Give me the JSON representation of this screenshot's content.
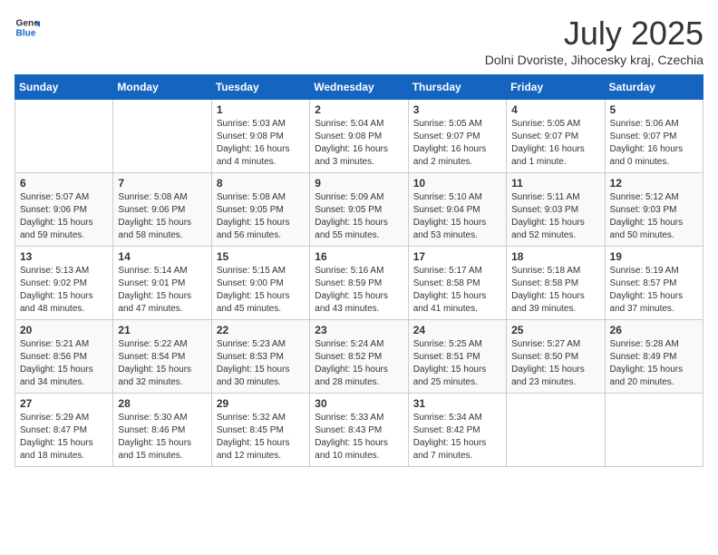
{
  "header": {
    "logo_general": "General",
    "logo_blue": "Blue",
    "title": "July 2025",
    "subtitle": "Dolni Dvoriste, Jihocesky kraj, Czechia"
  },
  "calendar": {
    "days_of_week": [
      "Sunday",
      "Monday",
      "Tuesday",
      "Wednesday",
      "Thursday",
      "Friday",
      "Saturday"
    ],
    "weeks": [
      [
        {
          "day": "",
          "info": ""
        },
        {
          "day": "",
          "info": ""
        },
        {
          "day": "1",
          "info": "Sunrise: 5:03 AM\nSunset: 9:08 PM\nDaylight: 16 hours\nand 4 minutes."
        },
        {
          "day": "2",
          "info": "Sunrise: 5:04 AM\nSunset: 9:08 PM\nDaylight: 16 hours\nand 3 minutes."
        },
        {
          "day": "3",
          "info": "Sunrise: 5:05 AM\nSunset: 9:07 PM\nDaylight: 16 hours\nand 2 minutes."
        },
        {
          "day": "4",
          "info": "Sunrise: 5:05 AM\nSunset: 9:07 PM\nDaylight: 16 hours\nand 1 minute."
        },
        {
          "day": "5",
          "info": "Sunrise: 5:06 AM\nSunset: 9:07 PM\nDaylight: 16 hours\nand 0 minutes."
        }
      ],
      [
        {
          "day": "6",
          "info": "Sunrise: 5:07 AM\nSunset: 9:06 PM\nDaylight: 15 hours\nand 59 minutes."
        },
        {
          "day": "7",
          "info": "Sunrise: 5:08 AM\nSunset: 9:06 PM\nDaylight: 15 hours\nand 58 minutes."
        },
        {
          "day": "8",
          "info": "Sunrise: 5:08 AM\nSunset: 9:05 PM\nDaylight: 15 hours\nand 56 minutes."
        },
        {
          "day": "9",
          "info": "Sunrise: 5:09 AM\nSunset: 9:05 PM\nDaylight: 15 hours\nand 55 minutes."
        },
        {
          "day": "10",
          "info": "Sunrise: 5:10 AM\nSunset: 9:04 PM\nDaylight: 15 hours\nand 53 minutes."
        },
        {
          "day": "11",
          "info": "Sunrise: 5:11 AM\nSunset: 9:03 PM\nDaylight: 15 hours\nand 52 minutes."
        },
        {
          "day": "12",
          "info": "Sunrise: 5:12 AM\nSunset: 9:03 PM\nDaylight: 15 hours\nand 50 minutes."
        }
      ],
      [
        {
          "day": "13",
          "info": "Sunrise: 5:13 AM\nSunset: 9:02 PM\nDaylight: 15 hours\nand 48 minutes."
        },
        {
          "day": "14",
          "info": "Sunrise: 5:14 AM\nSunset: 9:01 PM\nDaylight: 15 hours\nand 47 minutes."
        },
        {
          "day": "15",
          "info": "Sunrise: 5:15 AM\nSunset: 9:00 PM\nDaylight: 15 hours\nand 45 minutes."
        },
        {
          "day": "16",
          "info": "Sunrise: 5:16 AM\nSunset: 8:59 PM\nDaylight: 15 hours\nand 43 minutes."
        },
        {
          "day": "17",
          "info": "Sunrise: 5:17 AM\nSunset: 8:58 PM\nDaylight: 15 hours\nand 41 minutes."
        },
        {
          "day": "18",
          "info": "Sunrise: 5:18 AM\nSunset: 8:58 PM\nDaylight: 15 hours\nand 39 minutes."
        },
        {
          "day": "19",
          "info": "Sunrise: 5:19 AM\nSunset: 8:57 PM\nDaylight: 15 hours\nand 37 minutes."
        }
      ],
      [
        {
          "day": "20",
          "info": "Sunrise: 5:21 AM\nSunset: 8:56 PM\nDaylight: 15 hours\nand 34 minutes."
        },
        {
          "day": "21",
          "info": "Sunrise: 5:22 AM\nSunset: 8:54 PM\nDaylight: 15 hours\nand 32 minutes."
        },
        {
          "day": "22",
          "info": "Sunrise: 5:23 AM\nSunset: 8:53 PM\nDaylight: 15 hours\nand 30 minutes."
        },
        {
          "day": "23",
          "info": "Sunrise: 5:24 AM\nSunset: 8:52 PM\nDaylight: 15 hours\nand 28 minutes."
        },
        {
          "day": "24",
          "info": "Sunrise: 5:25 AM\nSunset: 8:51 PM\nDaylight: 15 hours\nand 25 minutes."
        },
        {
          "day": "25",
          "info": "Sunrise: 5:27 AM\nSunset: 8:50 PM\nDaylight: 15 hours\nand 23 minutes."
        },
        {
          "day": "26",
          "info": "Sunrise: 5:28 AM\nSunset: 8:49 PM\nDaylight: 15 hours\nand 20 minutes."
        }
      ],
      [
        {
          "day": "27",
          "info": "Sunrise: 5:29 AM\nSunset: 8:47 PM\nDaylight: 15 hours\nand 18 minutes."
        },
        {
          "day": "28",
          "info": "Sunrise: 5:30 AM\nSunset: 8:46 PM\nDaylight: 15 hours\nand 15 minutes."
        },
        {
          "day": "29",
          "info": "Sunrise: 5:32 AM\nSunset: 8:45 PM\nDaylight: 15 hours\nand 12 minutes."
        },
        {
          "day": "30",
          "info": "Sunrise: 5:33 AM\nSunset: 8:43 PM\nDaylight: 15 hours\nand 10 minutes."
        },
        {
          "day": "31",
          "info": "Sunrise: 5:34 AM\nSunset: 8:42 PM\nDaylight: 15 hours\nand 7 minutes."
        },
        {
          "day": "",
          "info": ""
        },
        {
          "day": "",
          "info": ""
        }
      ]
    ]
  }
}
